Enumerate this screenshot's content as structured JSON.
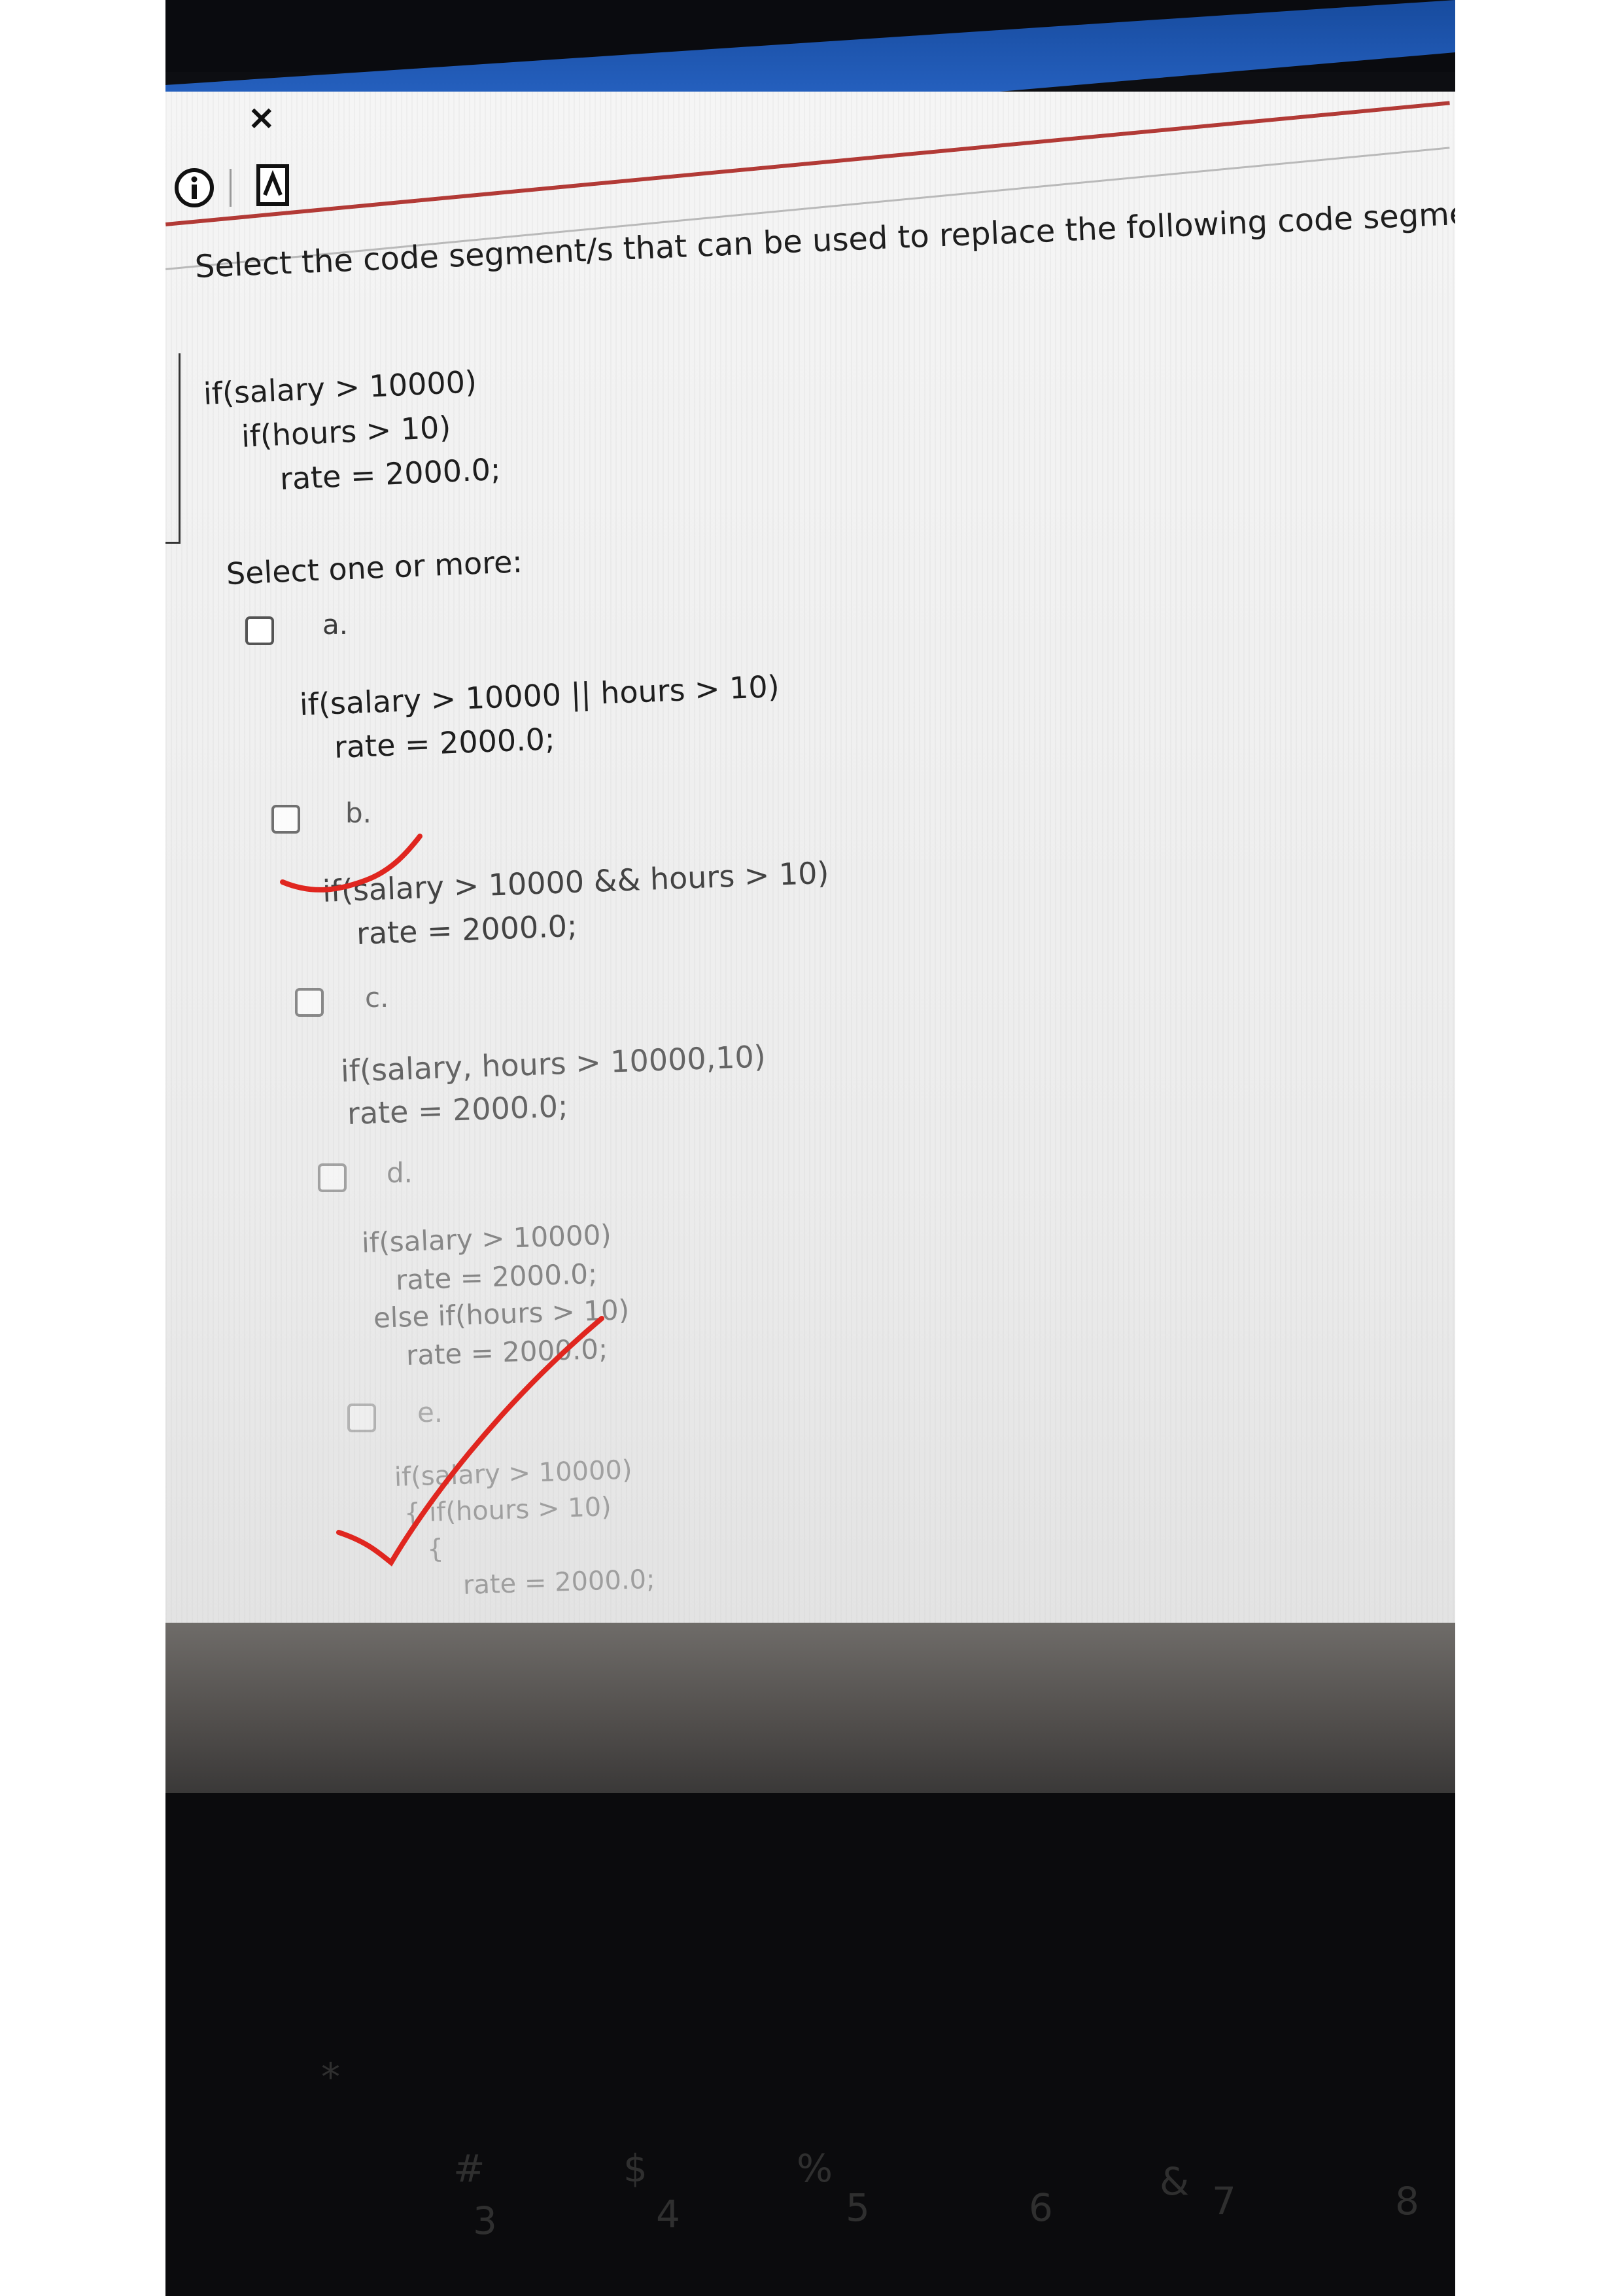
{
  "window": {
    "close_glyph": "×",
    "info_icon": "info-icon",
    "doc_icon": "document-icon"
  },
  "question": {
    "prompt": "Select the code segment/s that can be used to replace the following code segment.",
    "code": [
      "if(salary > 10000)",
      "if(hours > 10)",
      "rate = 2000.0;"
    ],
    "instruction": "Select one or more:"
  },
  "options": [
    {
      "letter": "a.",
      "code": [
        "if(salary > 10000 || hours > 10)",
        "rate = 2000.0;"
      ]
    },
    {
      "letter": "b.",
      "code": [
        "if(salary > 10000 && hours > 10)",
        "rate = 2000.0;"
      ]
    },
    {
      "letter": "c.",
      "code": [
        "if(salary, hours > 10000,10)",
        "rate = 2000.0;"
      ]
    },
    {
      "letter": "d.",
      "code": [
        "if(salary > 10000)",
        "rate = 2000.0;",
        "else if(hours > 10)",
        "rate = 2000.0;"
      ]
    },
    {
      "letter": "e.",
      "code": [
        "if(salary > 10000)",
        "{ if(hours > 10)",
        "{",
        "rate = 2000.0;"
      ]
    }
  ],
  "keyboard_keys": [
    "*",
    "#",
    "3",
    "$",
    "4",
    "%",
    "5",
    "6",
    "&",
    "7",
    "8"
  ],
  "colors": {
    "annotation_red": "#e0261f",
    "accent_blue": "#2f6fd6",
    "toolbar_red": "#b23a36"
  }
}
